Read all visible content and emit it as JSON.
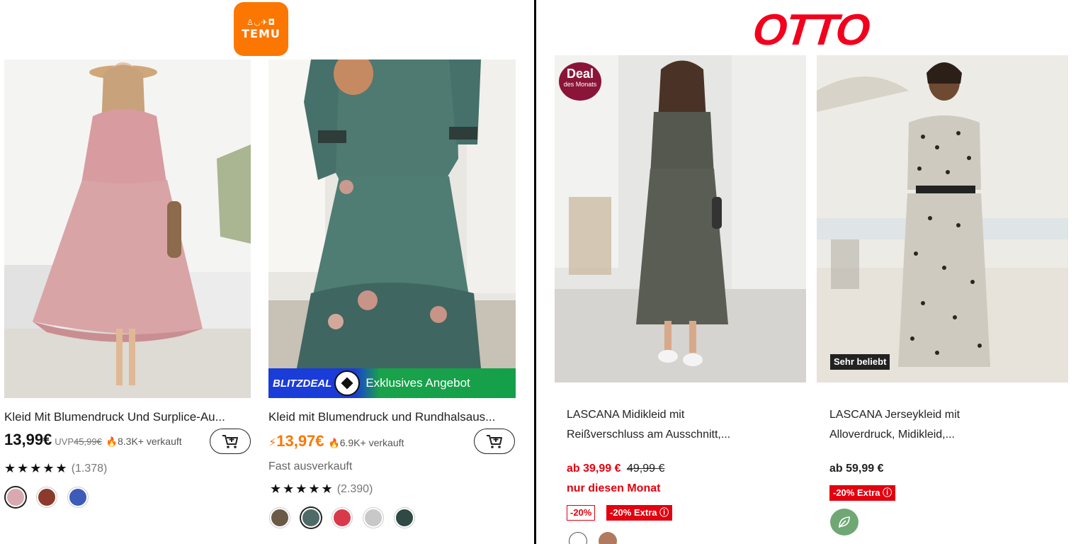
{
  "temu": {
    "brand": "TEMU",
    "products": [
      {
        "title": "Kleid Mit Blumendruck Und Surplice-Au...",
        "price": "13,99€",
        "uvp_label": "UVP",
        "uvp_price": "45,99€",
        "sold": "8.3K+ verkauft",
        "rating": 4.5,
        "stars": "★★★★★",
        "rating_count": "(1.378)",
        "swatch_colors": [
          "#d9a9b0",
          "#8b3a2c",
          "#3d5bb8"
        ],
        "selected_swatch": 0
      },
      {
        "title": "Kleid mit Blumendruck und Rundhalsaus...",
        "price": "13,97€",
        "sold": "6.9K+ verkauft",
        "note": "Fast ausverkauft",
        "rating": 5,
        "stars": "★★★★★",
        "rating_count": "(2.390)",
        "flash_banner": "BLITZDEAL",
        "flash_text": "Exklusives Angebot",
        "swatch_colors": [
          "#6b5a45",
          "#4e6b68",
          "#d83a4a",
          "#c8c8c8",
          "#2f4a45"
        ],
        "selected_swatch": 1
      }
    ]
  },
  "otto": {
    "brand": "OTTO",
    "products": [
      {
        "deal_line1": "Deal",
        "deal_line2": "des Monats",
        "title_line1": "LASCANA Midikleid mit",
        "title_line2": "Reißverschluss am Ausschnitt,...",
        "price": "ab 39,99 €",
        "old_price": "49,99 €",
        "promo": "nur diesen Monat",
        "badge1": "-20%",
        "badge2": "-20% Extra ⓘ"
      },
      {
        "label": "Sehr beliebt",
        "title_line1": "LASCANA Jerseykleid mit",
        "title_line2": "Alloverdruck, Midikleid,...",
        "price": "ab 59,99 €",
        "badge1": "-20% Extra ⓘ",
        "eco_icon": "leaf-icon"
      }
    ]
  }
}
